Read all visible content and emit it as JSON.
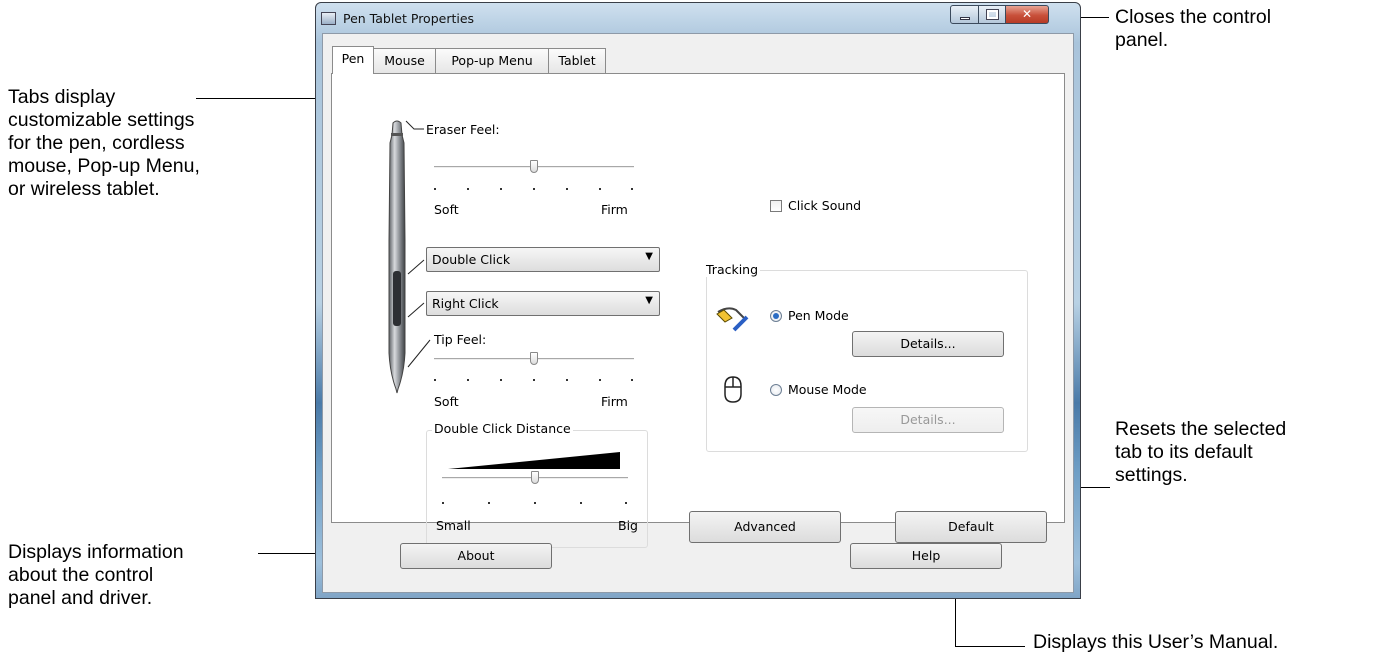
{
  "window": {
    "title": "Pen Tablet Properties"
  },
  "tabs": [
    {
      "label": "Pen"
    },
    {
      "label": "Mouse"
    },
    {
      "label": "Pop-up Menu"
    },
    {
      "label": "Tablet"
    }
  ],
  "pen_panel": {
    "eraser_feel": {
      "label": "Eraser Feel:",
      "min_label": "Soft",
      "max_label": "Firm",
      "value_fraction": 0.5
    },
    "side_button_upper": {
      "selected": "Double Click"
    },
    "side_button_lower": {
      "selected": "Right Click"
    },
    "tip_feel": {
      "label": "Tip Feel:",
      "min_label": "Soft",
      "max_label": "Firm",
      "value_fraction": 0.5
    },
    "double_click_distance": {
      "label": "Double Click Distance",
      "min_label": "Small",
      "max_label": "Big",
      "value_fraction": 0.5
    },
    "click_sound": {
      "label": "Click Sound",
      "checked": false
    },
    "tracking": {
      "label": "Tracking",
      "pen_mode": {
        "label": "Pen Mode",
        "selected": true,
        "details_label": "Details..."
      },
      "mouse_mode": {
        "label": "Mouse Mode",
        "selected": false,
        "details_label": "Details..."
      }
    },
    "advanced_label": "Advanced",
    "default_label": "Default"
  },
  "footer": {
    "about_label": "About",
    "help_label": "Help"
  },
  "callouts": {
    "tabs": "Tabs display\ncustomizable settings\nfor the pen, cordless\nmouse, Pop-up Menu,\nor wireless tablet.",
    "close": "Closes the control\npanel.",
    "default": "Resets the selected\ntab to its default\nsettings.",
    "about": "Displays information\nabout the control\npanel and driver.",
    "help": "Displays this User’s Manual."
  }
}
